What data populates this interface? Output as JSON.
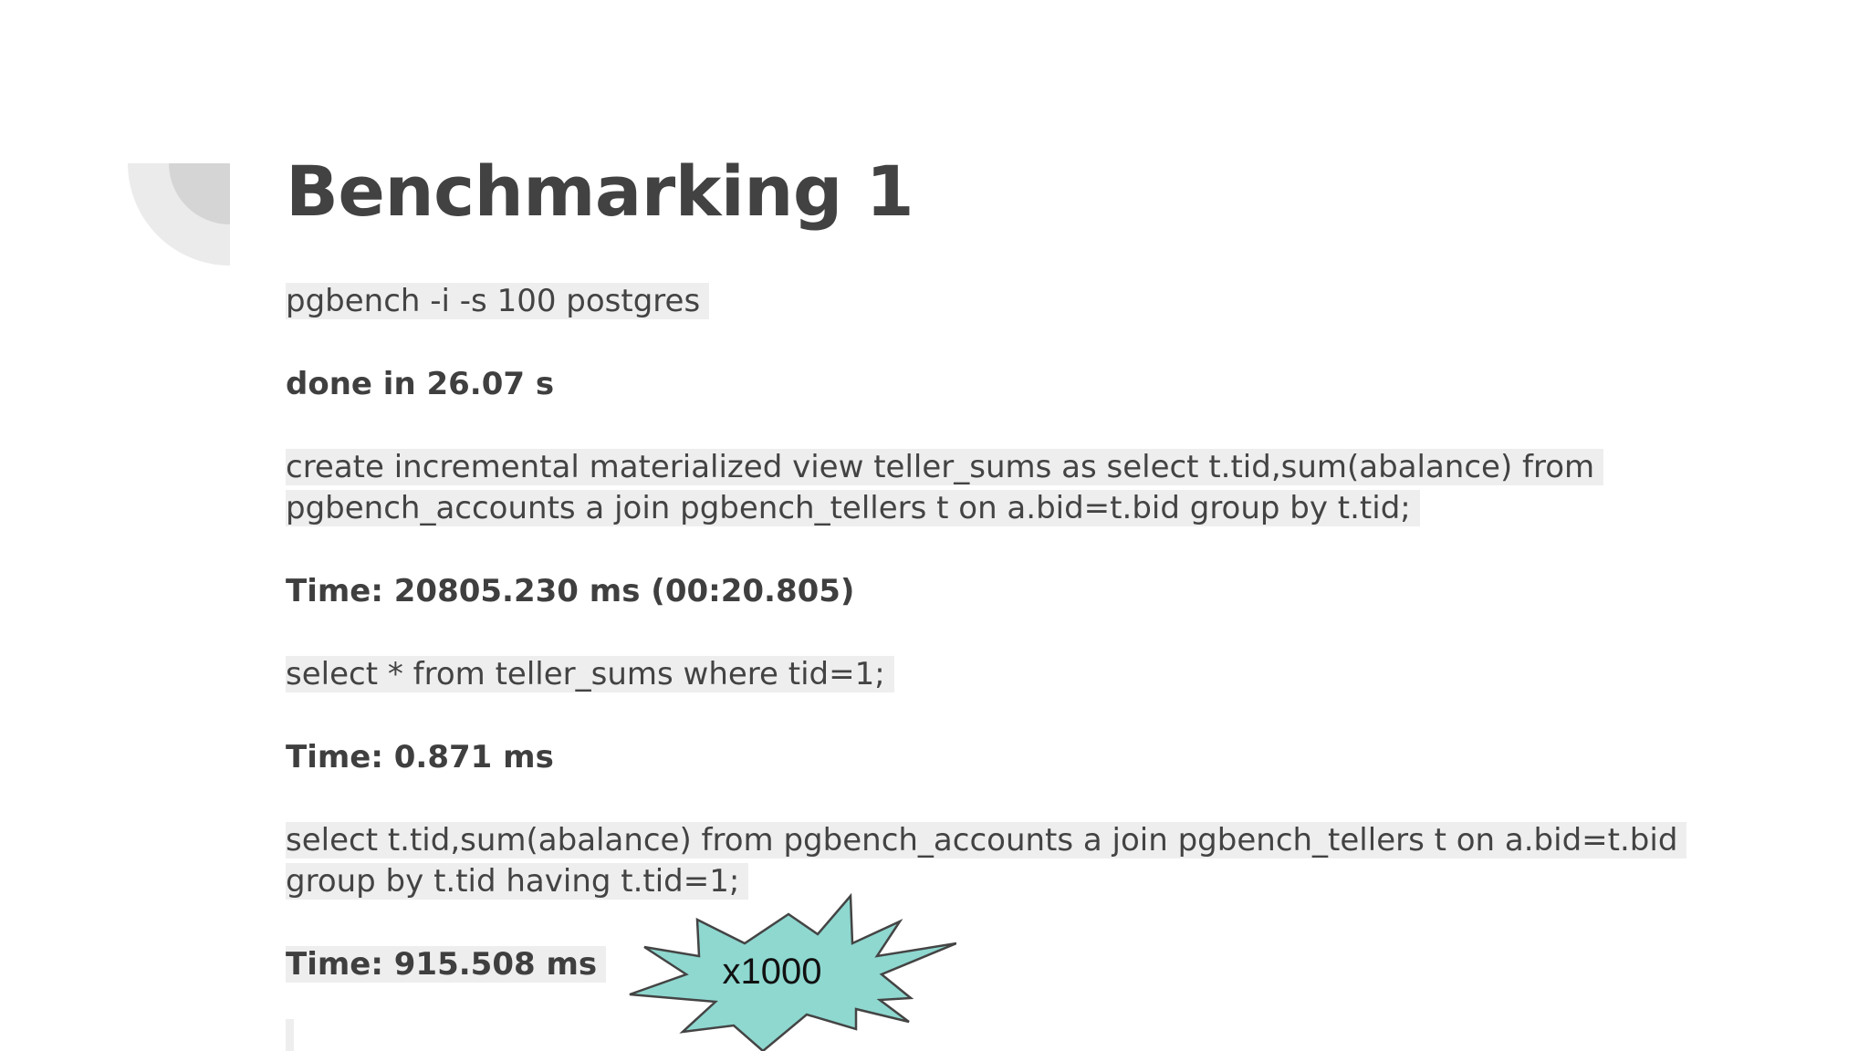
{
  "slide": {
    "title": "Benchmarking 1"
  },
  "content": {
    "cmd_init": "pgbench -i -s 100 postgres",
    "result_init": "done in 26.07 s",
    "cmd_create_line1": "create incremental materialized view teller_sums as select t.tid,sum(abalance) from",
    "cmd_create_line2": "pgbench_accounts a join pgbench_tellers t on a.bid=t.bid group by t.tid;",
    "result_create": "Time: 20805.230 ms (00:20.805)",
    "cmd_select_view": "select * from teller_sums where tid=1;",
    "result_select_view": "Time: 0.871 ms",
    "cmd_select_raw_line1": "select t.tid,sum(abalance) from pgbench_accounts a join pgbench_tellers t on a.bid=t.bid",
    "cmd_select_raw_line2": "group by t.tid having t.tid=1;",
    "result_select_raw": "Time: 915.508 ms"
  },
  "callout": {
    "label": "x1000",
    "fill_color": "#8ed8d0",
    "stroke_color": "#444444"
  },
  "colors": {
    "text": "#414141",
    "highlight": "#eeeeee",
    "decoration_outer": "#ebebeb",
    "decoration_inner": "#d5d5d5"
  }
}
